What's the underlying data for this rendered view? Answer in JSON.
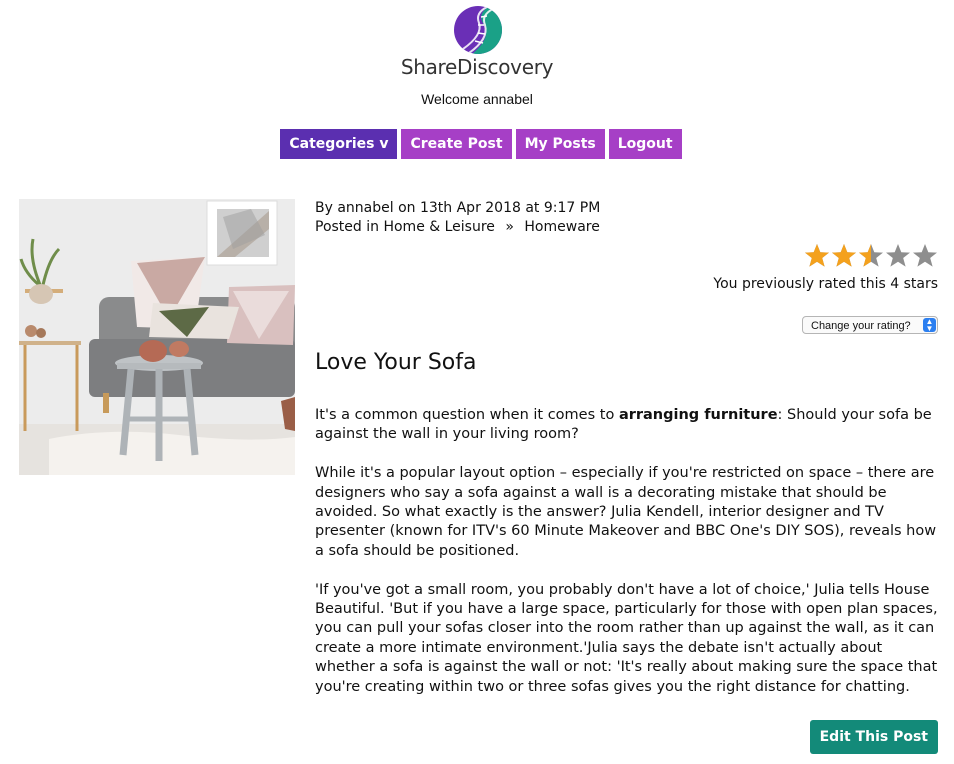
{
  "brand": {
    "name": "ShareDiscovery",
    "colors": {
      "purple": "#5b2fb0",
      "teal": "#1aa187"
    }
  },
  "welcome": "Welcome annabel",
  "nav": {
    "categories": "Categories v",
    "create_post": "Create Post",
    "my_posts": "My Posts",
    "logout": "Logout"
  },
  "post": {
    "by_line": "By annabel on 13th Apr 2018 at 9:17 PM",
    "posted_in_label": "Posted in",
    "category": "Home & Leisure",
    "separator": "»",
    "subcategory": "Homeware",
    "title": "Love Your Sofa",
    "paragraphs": {
      "p1_before": "It's a common question when it comes to ",
      "p1_bold": "arranging furniture",
      "p1_after": ": Should your sofa be against the wall in your living room?",
      "p2": "While it's a popular layout option – especially if you're restricted on space – there are designers who say a sofa against a wall is a decorating mistake that should be avoided. So what exactly is the answer? Julia Kendell, interior designer and TV presenter (known for ITV's 60 Minute Makeover and BBC One's DIY SOS), reveals how a sofa should be positioned.",
      "p3": "'If you've got a small room, you probably don't have a lot of choice,' Julia tells House Beautiful. 'But if you have a large space, particularly for those with open plan spaces, you can pull your sofas closer into the room rather than up against the wall, as it can create a more intimate environment.'Julia says the debate isn't actually about whether a sofa is against the wall or not: 'It's really about making sure the space that you're creating within two or three sofas gives you the right distance for chatting."
    },
    "edit_label": "Edit This Post"
  },
  "rating": {
    "average_stars": 2.5,
    "max_stars": 5,
    "star_color": "#f4a11d",
    "empty_star_color": "#8e8e8e",
    "previous_text": "You previously rated this 4 stars",
    "change_select": "Change your rating?"
  }
}
